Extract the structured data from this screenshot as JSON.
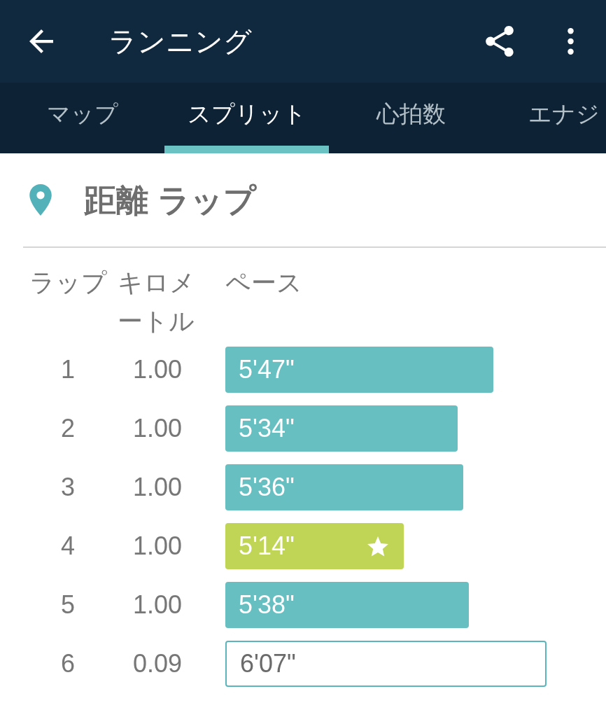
{
  "app_bar": {
    "title": "ランニング"
  },
  "tabs": [
    {
      "label": "マップ",
      "selected": false
    },
    {
      "label": "スプリット",
      "selected": true
    },
    {
      "label": "心拍数",
      "selected": false
    },
    {
      "label": "エナジ",
      "selected": false
    }
  ],
  "section": {
    "title": "距離 ラップ"
  },
  "table": {
    "columns": [
      "ラップ",
      "キロメートル",
      "ペース"
    ],
    "rows": [
      {
        "lap": "1",
        "distance": "1.00",
        "pace": "5'47\"",
        "kind": "normal",
        "level": 0.766
      },
      {
        "lap": "2",
        "distance": "1.00",
        "pace": "5'34\"",
        "kind": "normal",
        "level": 0.664
      },
      {
        "lap": "3",
        "distance": "1.00",
        "pace": "5'36\"",
        "kind": "normal",
        "level": 0.68
      },
      {
        "lap": "4",
        "distance": "1.00",
        "pace": "5'14\"",
        "kind": "best",
        "level": 0.51
      },
      {
        "lap": "5",
        "distance": "1.00",
        "pace": "5'38\"",
        "kind": "normal",
        "level": 0.696
      },
      {
        "lap": "6",
        "distance": "0.09",
        "pace": "6'07\"",
        "kind": "partial",
        "level": 0.918
      }
    ]
  }
}
